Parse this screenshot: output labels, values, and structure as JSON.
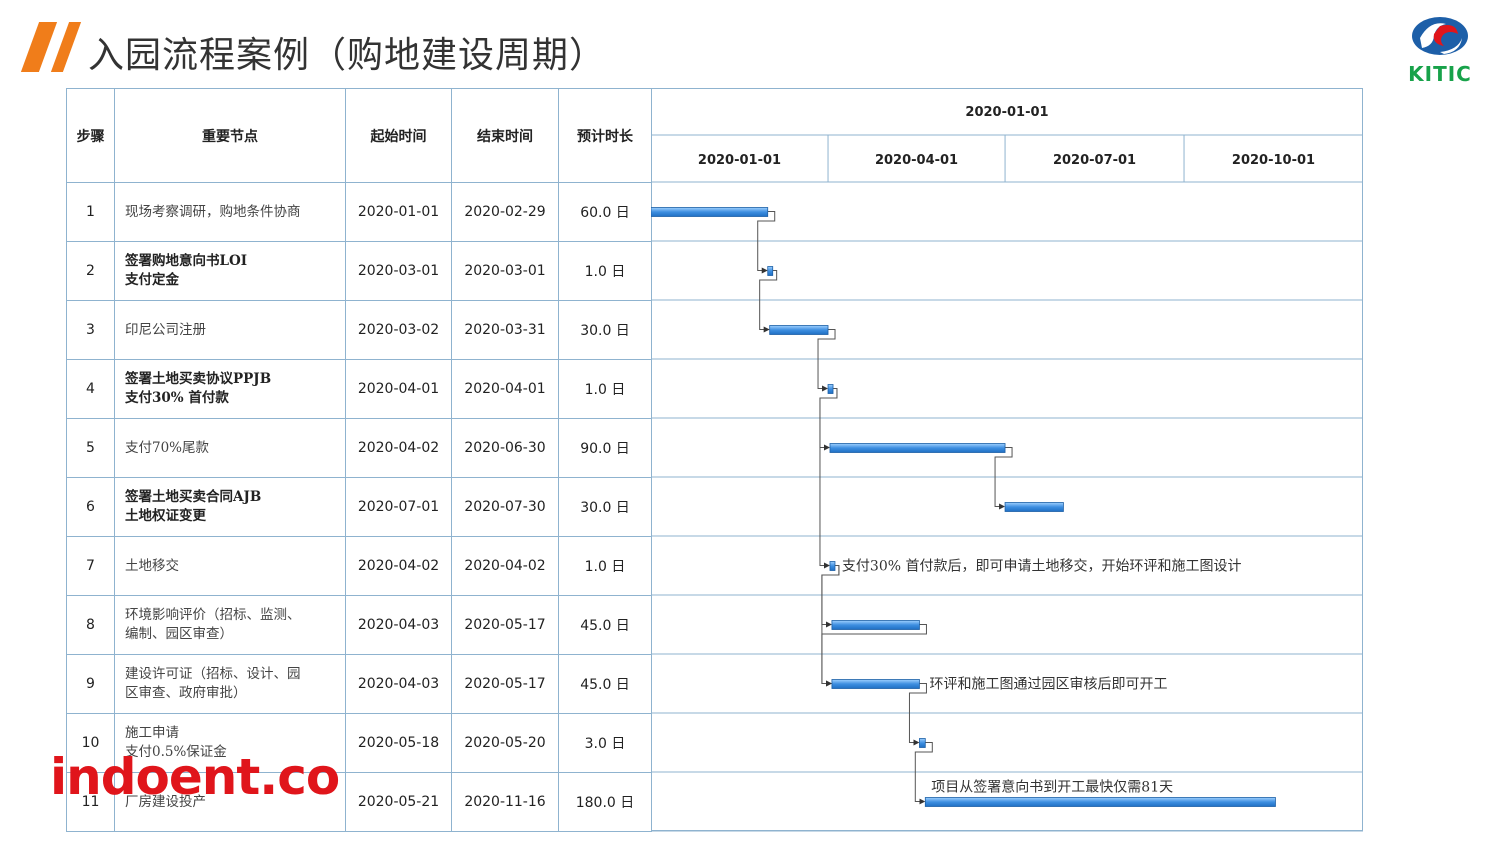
{
  "page": {
    "title": "入园流程案例（购地建设周期）",
    "logo_text": "KITIC",
    "watermark": "indoent.co",
    "accent_color": "#f07d1a",
    "logo_green": "#18a24a",
    "logo_blue": "#1d5fa8",
    "logo_red": "#e0151b"
  },
  "table": {
    "headers": [
      "步骤",
      "重要节点",
      "起始时间",
      "结束时间",
      "预计时长"
    ],
    "rows": [
      {
        "step": "1",
        "name_lines": [
          "现场考察调研，购地条件协商"
        ],
        "bold": false,
        "start": "2020-01-01",
        "end": "2020-02-29",
        "duration": "60.0 日"
      },
      {
        "step": "2",
        "name_lines": [
          "签署购地意向书LOI",
          "支付定金"
        ],
        "bold": true,
        "start": "2020-03-01",
        "end": "2020-03-01",
        "duration": "1.0 日"
      },
      {
        "step": "3",
        "name_lines": [
          "印尼公司注册"
        ],
        "bold": false,
        "start": "2020-03-02",
        "end": "2020-03-31",
        "duration": "30.0 日"
      },
      {
        "step": "4",
        "name_lines": [
          "签署土地买卖协议PPJB",
          "支付30% 首付款"
        ],
        "bold": true,
        "start": "2020-04-01",
        "end": "2020-04-01",
        "duration": "1.0 日"
      },
      {
        "step": "5",
        "name_lines": [
          "支付70%尾款"
        ],
        "bold": false,
        "start": "2020-04-02",
        "end": "2020-06-30",
        "duration": "90.0 日"
      },
      {
        "step": "6",
        "name_lines": [
          "签署土地买卖合同AJB",
          "土地权证变更"
        ],
        "bold": true,
        "start": "2020-07-01",
        "end": "2020-07-30",
        "duration": "30.0 日"
      },
      {
        "step": "7",
        "name_lines": [
          "土地移交"
        ],
        "bold": false,
        "start": "2020-04-02",
        "end": "2020-04-02",
        "duration": "1.0 日"
      },
      {
        "step": "8",
        "name_lines": [
          "环境影响评价（招标、监测、",
          "编制、园区审查）"
        ],
        "bold": false,
        "start": "2020-04-03",
        "end": "2020-05-17",
        "duration": "45.0 日"
      },
      {
        "step": "9",
        "name_lines": [
          "建设许可证（招标、设计、园",
          "区审查、政府审批）"
        ],
        "bold": false,
        "start": "2020-04-03",
        "end": "2020-05-17",
        "duration": "45.0 日"
      },
      {
        "step": "10",
        "name_lines": [
          "施工申请",
          "支付0.5%保证金"
        ],
        "bold": false,
        "start": "2020-05-18",
        "end": "2020-05-20",
        "duration": "3.0 日"
      },
      {
        "step": "11",
        "name_lines": [
          "厂房建设投产"
        ],
        "bold": false,
        "start": "2020-05-21",
        "end": "2020-11-16",
        "duration": "180.0 日"
      }
    ]
  },
  "chart_data": {
    "type": "gantt",
    "top_header": "2020-01-01",
    "quarter_labels": [
      "2020-01-01",
      "2020-04-01",
      "2020-07-01",
      "2020-10-01"
    ],
    "axis_start": "2020-01-01",
    "axis_end": "2020-12-31",
    "bar_color": "#3d8ee0",
    "tasks": [
      {
        "id": 1,
        "start": "2020-01-01",
        "end": "2020-02-29"
      },
      {
        "id": 2,
        "start": "2020-03-01",
        "end": "2020-03-01",
        "milestone": true
      },
      {
        "id": 3,
        "start": "2020-03-02",
        "end": "2020-03-31"
      },
      {
        "id": 4,
        "start": "2020-04-01",
        "end": "2020-04-01",
        "milestone": true
      },
      {
        "id": 5,
        "start": "2020-04-02",
        "end": "2020-06-30"
      },
      {
        "id": 6,
        "start": "2020-07-01",
        "end": "2020-07-30"
      },
      {
        "id": 7,
        "start": "2020-04-02",
        "end": "2020-04-02",
        "milestone": true
      },
      {
        "id": 8,
        "start": "2020-04-03",
        "end": "2020-05-17"
      },
      {
        "id": 9,
        "start": "2020-04-03",
        "end": "2020-05-17"
      },
      {
        "id": 10,
        "start": "2020-05-18",
        "end": "2020-05-20"
      },
      {
        "id": 11,
        "start": "2020-05-21",
        "end": "2020-11-16"
      }
    ],
    "dependencies": [
      [
        1,
        2
      ],
      [
        2,
        3
      ],
      [
        3,
        4
      ],
      [
        4,
        5
      ],
      [
        5,
        6
      ],
      [
        4,
        7
      ],
      [
        7,
        8
      ],
      [
        7,
        9
      ],
      [
        8,
        9
      ],
      [
        9,
        10
      ],
      [
        10,
        11
      ]
    ],
    "annotations": [
      {
        "task": 7,
        "text": "支付30% 首付款后，即可申请土地移交，开始环评和施工图设计"
      },
      {
        "task": 9,
        "text": "环评和施工图通过园区审核后即可开工"
      },
      {
        "task": 11,
        "text": "项目从签署意向书到开工最快仅需81天",
        "above": true
      }
    ]
  }
}
